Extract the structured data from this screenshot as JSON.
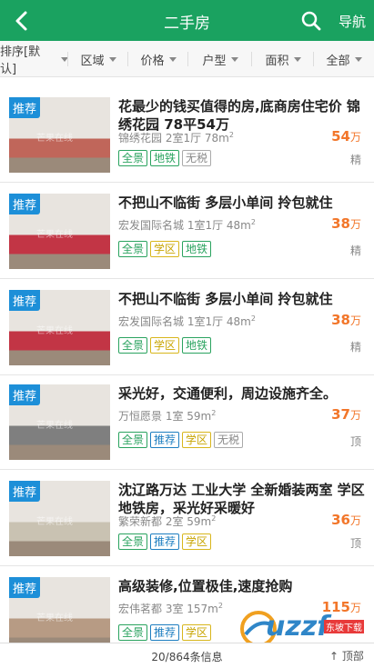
{
  "header": {
    "title": "二手房",
    "nav_label": "导航"
  },
  "filters": [
    "排序[默认]",
    "区域",
    "价格",
    "户型",
    "面积",
    "全部"
  ],
  "listings": [
    {
      "tag": "推荐",
      "title": "花最少的钱买值得的房,底商房住宅价 锦绣花园 78平54万",
      "meta": "锦绣花园 2室1厅 78m",
      "meta_sup": "2",
      "price": "54",
      "price_unit": "万",
      "ptype": "精",
      "badges": [
        {
          "t": "全景",
          "c": "green"
        },
        {
          "t": "地铁",
          "c": "green"
        },
        {
          "t": "无税",
          "c": "gray"
        }
      ],
      "img_color": "#c0665a"
    },
    {
      "tag": "推荐",
      "title": "不把山不临街 多层小单间 拎包就住",
      "meta": "宏发国际名城 1室1厅 48m",
      "meta_sup": "2",
      "price": "38",
      "price_unit": "万",
      "ptype": "精",
      "badges": [
        {
          "t": "全景",
          "c": "green"
        },
        {
          "t": "学区",
          "c": "yellow"
        },
        {
          "t": "地铁",
          "c": "green"
        }
      ],
      "img_color": "#c23545"
    },
    {
      "tag": "推荐",
      "title": "不把山不临街 多层小单间 拎包就住",
      "meta": "宏发国际名城 1室1厅 48m",
      "meta_sup": "2",
      "price": "38",
      "price_unit": "万",
      "ptype": "精",
      "badges": [
        {
          "t": "全景",
          "c": "green"
        },
        {
          "t": "学区",
          "c": "yellow"
        },
        {
          "t": "地铁",
          "c": "green"
        }
      ],
      "img_color": "#c23545"
    },
    {
      "tag": "推荐",
      "title": "采光好，交通便利，周边设施齐全。",
      "meta": "万恒愿景 1室 59m",
      "meta_sup": "2",
      "price": "37",
      "price_unit": "万",
      "ptype": "顶",
      "badges": [
        {
          "t": "全景",
          "c": "green"
        },
        {
          "t": "推荐",
          "c": "blue"
        },
        {
          "t": "学区",
          "c": "yellow"
        },
        {
          "t": "无税",
          "c": "gray"
        }
      ],
      "img_color": "#7f7f7f"
    },
    {
      "tag": "推荐",
      "title": "沈辽路万达 工业大学 全新婚装两室 学区地铁房，采光好采暖好",
      "meta": "繁荣新都 2室 59m",
      "meta_sup": "2",
      "price": "36",
      "price_unit": "万",
      "ptype": "顶",
      "badges": [
        {
          "t": "全景",
          "c": "green"
        },
        {
          "t": "推荐",
          "c": "blue"
        },
        {
          "t": "学区",
          "c": "yellow"
        }
      ],
      "img_color": "#c9c2b2"
    },
    {
      "tag": "推荐",
      "title": "高级装修,位置极佳,速度抢购",
      "meta": "宏伟茗都 3室 157m",
      "meta_sup": "2",
      "price": "115",
      "price_unit": "万",
      "ptype": "",
      "badges": [
        {
          "t": "全景",
          "c": "green"
        },
        {
          "t": "推荐",
          "c": "blue"
        },
        {
          "t": "学区",
          "c": "yellow"
        }
      ],
      "img_color": "#b79b84"
    }
  ],
  "watermark_text": "芒果在线",
  "footer": {
    "count": "20/864条信息",
    "top": "顶部"
  },
  "logo": {
    "text": "uzzf",
    "sub": "东坡下载"
  },
  "colors": {
    "header": "#1aa260",
    "price": "#f2762a",
    "tag": "#1d8fd8"
  }
}
